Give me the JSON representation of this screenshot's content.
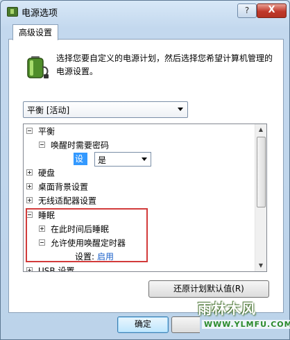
{
  "window": {
    "title": "电源选项",
    "help_label": "?",
    "close_label": "X"
  },
  "tab": {
    "label": "高级设置"
  },
  "description": "选择您要自定义的电源计划，然后选择您希望计算机管理的电源设置。",
  "plan_dropdown": {
    "selected": "平衡 [活动]"
  },
  "tree": {
    "items": [
      {
        "label": "平衡",
        "expander": "minus"
      },
      {
        "label": "唤醒时需要密码",
        "expander": "minus"
      },
      {
        "label": "硬盘",
        "expander": "plus"
      },
      {
        "label": "桌面背景设置",
        "expander": "plus"
      },
      {
        "label": "无线适配器设置",
        "expander": "plus"
      },
      {
        "label": "睡眠",
        "expander": "minus"
      },
      {
        "label": "在此时间后睡眠",
        "expander": "plus"
      },
      {
        "label": "允许使用唤醒定时器",
        "expander": "minus"
      },
      {
        "label": "USB 设置",
        "expander": "plus"
      }
    ],
    "password_setting": {
      "label": "设置:",
      "value": "是"
    },
    "wake_timer_setting": {
      "label": "设置:",
      "value": "启用"
    }
  },
  "buttons": {
    "restore_defaults": "还原计划默认值(R)",
    "ok": "确定"
  },
  "watermark": {
    "text": "雨林木风",
    "url": "WWW.YLMFU.COM"
  },
  "colors": {
    "highlight_box": "#d23a3a",
    "selection": "#3399ff",
    "link": "#1a5fc8"
  }
}
